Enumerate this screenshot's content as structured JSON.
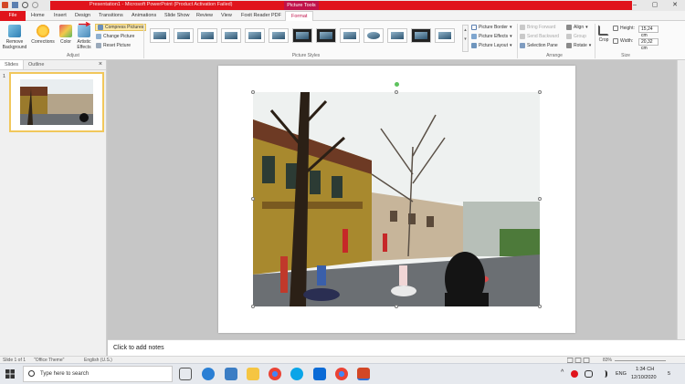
{
  "titlebar": {
    "title": "Presentation1 - Microsoft PowerPoint (Product Activation Failed)",
    "context_tab": "Picture Tools"
  },
  "tabs": [
    "File",
    "Home",
    "Insert",
    "Design",
    "Transitions",
    "Animations",
    "Slide Show",
    "Review",
    "View",
    "Foxit Reader PDF",
    "Format"
  ],
  "ribbon": {
    "adjust": {
      "remove_background": "Remove Background",
      "corrections": "Corrections",
      "color": "Color",
      "artistic_effects": "Artistic Effects",
      "compress_pictures": "Compress Pictures",
      "change_picture": "Change Picture",
      "reset_picture": "Reset Picture",
      "label": "Adjust"
    },
    "picture_styles": {
      "label": "Picture Styles",
      "picture_border": "Picture Border",
      "picture_effects": "Picture Effects",
      "picture_layout": "Picture Layout"
    },
    "arrange": {
      "label": "Arrange",
      "bring_forward": "Bring Forward",
      "send_backward": "Send Backward",
      "selection_pane": "Selection Pane",
      "align": "Align",
      "group": "Group",
      "rotate": "Rotate"
    },
    "size": {
      "label": "Size",
      "crop": "Crop",
      "height_label": "Height:",
      "height_value": "15,24 cm",
      "width_label": "Width:",
      "width_value": "20,32 cm"
    }
  },
  "leftpane": {
    "tabs": [
      "Slides",
      "Outline"
    ],
    "close": "×",
    "slide_number": "1"
  },
  "notes": {
    "placeholder": "Click to add notes"
  },
  "statusbar": {
    "slide_info": "Slide 1 of 1",
    "theme": "\"Office Theme\"",
    "language": "English (U.S.)",
    "zoom": "83%"
  },
  "taskbar": {
    "search_placeholder": "Type here to search",
    "language": "ENG",
    "time": "1:34 CH",
    "date": "12/10/2020",
    "notifications": "5"
  },
  "colors": {
    "accent_red": "#e0141c",
    "picture_tools": "#c0124a",
    "selection_yellow": "#f1c75b"
  }
}
